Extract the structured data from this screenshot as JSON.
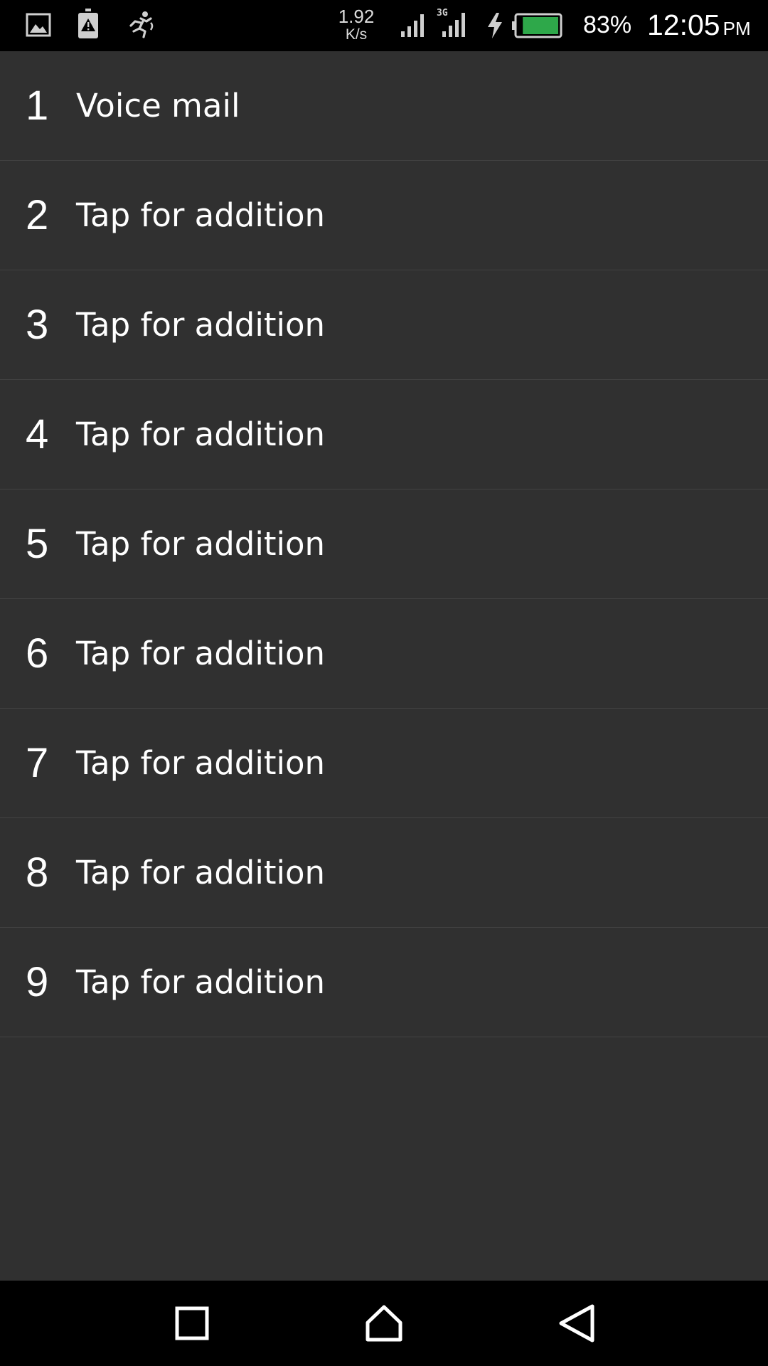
{
  "status_bar": {
    "icons": [
      "gallery-icon",
      "storage-warning-icon",
      "activity-runner-icon",
      "signal-icon",
      "signal-3g-icon",
      "charging-icon",
      "battery-icon"
    ],
    "net_speed_value": "1.92",
    "net_speed_unit": "K/s",
    "network_type": "3G",
    "battery_percent": "83%",
    "battery_level": 0.83,
    "time": "12:05",
    "ampm": "PM"
  },
  "speed_dial": {
    "items": [
      {
        "number": "1",
        "label": "Voice mail"
      },
      {
        "number": "2",
        "label": "Tap for addition"
      },
      {
        "number": "3",
        "label": "Tap for addition"
      },
      {
        "number": "4",
        "label": "Tap for addition"
      },
      {
        "number": "5",
        "label": "Tap for addition"
      },
      {
        "number": "6",
        "label": "Tap for addition"
      },
      {
        "number": "7",
        "label": "Tap for addition"
      },
      {
        "number": "8",
        "label": "Tap for addition"
      },
      {
        "number": "9",
        "label": "Tap for addition"
      }
    ]
  },
  "nav_bar": {
    "buttons": [
      "recents-square-icon",
      "home-icon",
      "back-triangle-icon"
    ]
  },
  "colors": {
    "background": "#303030",
    "divider": "#424242",
    "bars": "#000000",
    "text": "#ffffff",
    "battery_fill": "#2ea84a"
  }
}
